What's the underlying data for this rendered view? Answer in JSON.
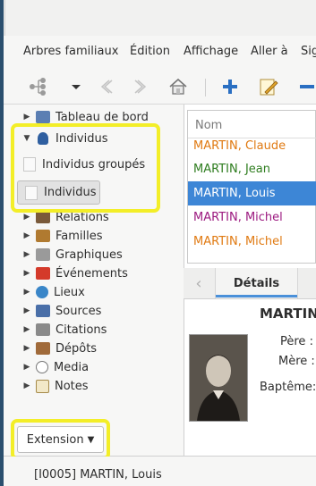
{
  "menu": {
    "items": [
      "Arbres familiaux",
      "Édition",
      "Affichage",
      "Aller à",
      "Sig"
    ]
  },
  "toolbar": {
    "buttons": [
      "tree-icon",
      "dropdown-arrow",
      "back-icon",
      "forward-icon",
      "home-icon",
      "add-icon",
      "edit-icon",
      "remove-icon"
    ]
  },
  "sidebar": {
    "items": [
      {
        "label": "Tableau de bord",
        "icon": "dashboard-icon"
      },
      {
        "label": "Individus",
        "icon": "person-icon"
      },
      {
        "label": "Relations",
        "icon": "relations-icon"
      },
      {
        "label": "Familles",
        "icon": "family-icon"
      },
      {
        "label": "Graphiques",
        "icon": "chart-icon"
      },
      {
        "label": "Événements",
        "icon": "calendar-icon"
      },
      {
        "label": "Lieux",
        "icon": "globe-icon"
      },
      {
        "label": "Sources",
        "icon": "book-icon"
      },
      {
        "label": "Citations",
        "icon": "citation-icon"
      },
      {
        "label": "Dépôts",
        "icon": "repository-icon"
      },
      {
        "label": "Media",
        "icon": "media-icon"
      },
      {
        "label": "Notes",
        "icon": "notes-icon"
      }
    ],
    "views": {
      "grouped": "Individus groupés",
      "flat": "Individus"
    },
    "extension_label": "Extension"
  },
  "list": {
    "column_header": "Nom",
    "rows": [
      {
        "name": "MARTIN, Claude",
        "color": "#e07a12"
      },
      {
        "name": "MARTIN, Jean",
        "color": "#2e7d1f"
      },
      {
        "name": "MARTIN, Louis",
        "color": "#ffffff"
      },
      {
        "name": "MARTIN, Michel",
        "color": "#9c1a80"
      },
      {
        "name": "MARTIN, Michel",
        "color": "#e07a12"
      }
    ],
    "selected_index": 2
  },
  "details": {
    "tab_label": "Détails",
    "title": "MARTIN",
    "pere_label": "Père :",
    "mere_label": "Mère :",
    "bapteme_label": "Baptême:"
  },
  "status": {
    "text": "[I0005] MARTIN, Louis"
  },
  "colors": {
    "accent": "#4a90d9",
    "highlight": "#f3ee28",
    "selection": "#3d86d6"
  }
}
